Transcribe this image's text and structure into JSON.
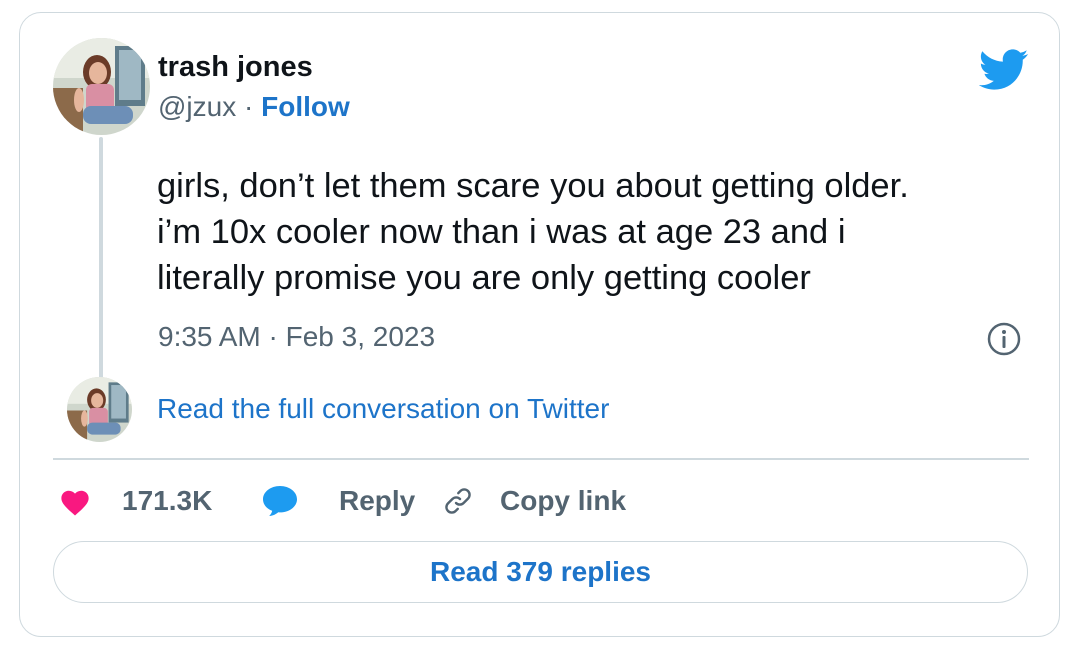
{
  "author": {
    "display_name": "trash jones",
    "handle": "@jzux",
    "separator": "·",
    "follow_label": "Follow"
  },
  "brand": {
    "icon": "twitter-bird-icon",
    "color": "#1d9bf0"
  },
  "tweet": {
    "text_lines": [
      "girls, don’t let them scare you about getting older.",
      "i’m 10x cooler now than i was at age 23 and i",
      "literally promise you are only getting cooler"
    ],
    "timestamp": "9:35 AM · Feb 3, 2023",
    "info_icon": "info-icon"
  },
  "conversation": {
    "link_label": "Read the full conversation on Twitter"
  },
  "actions": {
    "like_count": "171.3K",
    "like_icon": "heart-icon",
    "reply_label": "Reply",
    "reply_icon": "speech-bubble-icon",
    "copy_label": "Copy link",
    "copy_icon": "link-icon"
  },
  "footer": {
    "read_replies_label": "Read 379 replies"
  },
  "colors": {
    "text": "#0f1419",
    "secondary": "#536471",
    "link": "#1d74c9",
    "heart": "#f91880",
    "reply_bubble": "#1d9bf0",
    "border": "#cfd9de"
  }
}
